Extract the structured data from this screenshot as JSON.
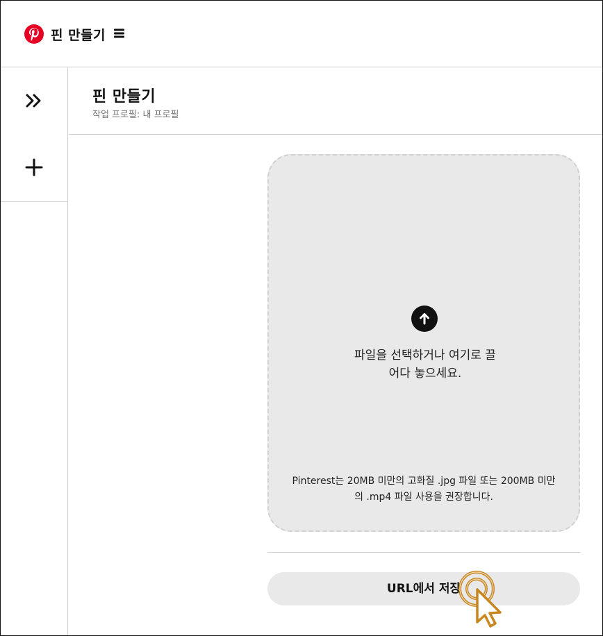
{
  "header": {
    "title": "핀 만들기",
    "logo_icon": "pinterest-logo",
    "menu_icon": "hamburger-icon",
    "brand_color": "#E60023"
  },
  "rail": {
    "expand_icon": "chevron-double-right-icon",
    "add_icon": "plus-icon"
  },
  "page": {
    "title": "핀 만들기",
    "subtitle": "작업 프로필: 내 프로필"
  },
  "upload": {
    "icon": "arrow-up-circle-icon",
    "prompt_line1": "파일을 선택하거나 여기로 끌",
    "prompt_line2": "어다 놓으세요.",
    "hint_line1": "Pinterest는 20MB 미만의 고화질 .jpg 파일 또는 200MB 미만",
    "hint_line2": "의 .mp4 파일 사용을 권장합니다."
  },
  "url_button": {
    "label": "URL에서 저장"
  },
  "cursor": {
    "icon": "pointer-cursor-click-icon",
    "color": "#C8861E"
  }
}
